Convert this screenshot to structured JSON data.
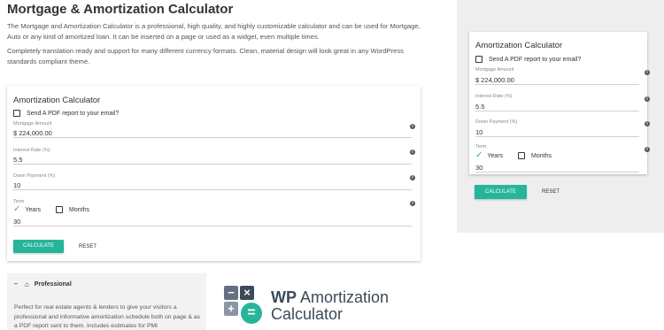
{
  "page": {
    "title": "Mortgage & Amortization Calculator",
    "intro1": "The Mortgage and Amortization Calculator is a professional, high quality, and highly customizable calculator and can be used for Mortgage, Auto or any kind of amortized loan.  It can be inserted on a page or used as a widget, even multiple times.",
    "intro2": "Completely translation ready and support for many different currency formats.  Clean, material design will look great in any WordPress standards compliant theme."
  },
  "calculator": {
    "title": "Amortization Calculator",
    "pdf_label": "Send A PDF report to your email?",
    "mortgage_label": "Mortgage Amount",
    "mortgage_value": "$ 224,000.00",
    "rate_label": "Interest Rate (%)",
    "rate_value": "5.5",
    "down_label": "Down Payment (%)",
    "down_value": "10",
    "term_label": "Term",
    "years_label": "Years",
    "months_label": "Months",
    "term_value": "30",
    "calculate_label": "CALCULATE",
    "reset_label": "RESET",
    "info_glyph": "i"
  },
  "promo": {
    "collapse_glyph": "–",
    "title": "Professional",
    "text": "Perfect for real estate agents & lenders to give your visitors a professional and informative amortization schedule both on page & as a PDF report sent to them.  Includes estimates for PMI"
  },
  "logo": {
    "minus": "−",
    "times": "×",
    "plus": "+",
    "equals": "=",
    "word_bold": "WP",
    "word_rest": " Amortization",
    "word2": "Calculator"
  },
  "colors": {
    "accent": "#26b59a",
    "logo_dark": "#3c4a59",
    "sidebar_bg": "#eeeeee"
  },
  "icons": [
    "info-icon",
    "checkmark-icon",
    "home-icon",
    "minus-icon"
  ]
}
